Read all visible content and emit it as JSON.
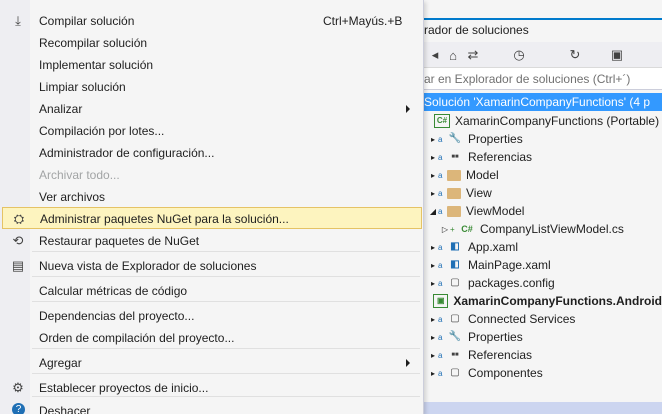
{
  "solution_explorer": {
    "title": "rador de soluciones",
    "search_placeholder": "ar en Explorador de soluciones (Ctrl+´)",
    "toolbar_icons": [
      "back-icon",
      "home-icon",
      "sync-view-icon",
      "history-icon",
      "refresh-icon",
      "collapse-icon"
    ],
    "tree": [
      {
        "label": "Solución 'XamarinCompanyFunctions'  (4 p",
        "kind": "solution",
        "indent": 0,
        "selected": true
      },
      {
        "label": "XamarinCompanyFunctions (Portable)",
        "kind": "project",
        "indent": 0
      },
      {
        "label": "Properties",
        "kind": "wrench",
        "indent": 1
      },
      {
        "label": "Referencias",
        "kind": "refs",
        "indent": 1
      },
      {
        "label": "Model",
        "kind": "folder",
        "indent": 1
      },
      {
        "label": "View",
        "kind": "folder",
        "indent": 1
      },
      {
        "label": "ViewModel",
        "kind": "folder",
        "indent": 1,
        "expanded": true
      },
      {
        "label": "CompanyListViewModel.cs",
        "kind": "cs",
        "indent": 2
      },
      {
        "label": "App.xaml",
        "kind": "xaml",
        "indent": 1
      },
      {
        "label": "MainPage.xaml",
        "kind": "xaml",
        "indent": 1
      },
      {
        "label": "packages.config",
        "kind": "cfg",
        "indent": 1
      },
      {
        "label": "XamarinCompanyFunctions.Android",
        "kind": "project-bold",
        "indent": 0
      },
      {
        "label": "Connected Services",
        "kind": "cfg",
        "indent": 1
      },
      {
        "label": "Properties",
        "kind": "wrench",
        "indent": 1
      },
      {
        "label": "Referencias",
        "kind": "refs",
        "indent": 1
      },
      {
        "label": "Componentes",
        "kind": "cfg",
        "indent": 1
      }
    ]
  },
  "menu": {
    "items": [
      {
        "label": "Compilar solución",
        "shortcut": "Ctrl+Mayús.+B",
        "icon": "build-icon"
      },
      {
        "label": "Recompilar solución"
      },
      {
        "label": "Implementar solución"
      },
      {
        "label": "Limpiar solución"
      },
      {
        "label": "Analizar",
        "submenu": true
      },
      {
        "label": "Compilación por lotes..."
      },
      {
        "label": "Administrador de configuración..."
      },
      {
        "label": "Archivar todo...",
        "disabled": true
      },
      {
        "label": "Ver archivos"
      },
      {
        "label": "Administrar paquetes NuGet para la solución...",
        "icon": "nuget-icon",
        "hover": true
      },
      {
        "label": "Restaurar paquetes de NuGet",
        "icon": "restore-icon"
      },
      {
        "label": "Nueva vista de Explorador de soluciones",
        "icon": "new-view-icon"
      },
      {
        "label": "Calcular métricas de código"
      },
      {
        "label": "Dependencias del proyecto..."
      },
      {
        "label": "Orden de compilación del proyecto..."
      },
      {
        "label": "Agregar",
        "submenu": true
      },
      {
        "label": "Establecer proyectos de inicio...",
        "icon": "gear-icon"
      },
      {
        "label": "Deshacer",
        "icon": "help-icon"
      }
    ]
  },
  "colors": {
    "accent": "#007acc",
    "selection": "#3399ff",
    "hover": "#fdf4bf"
  }
}
